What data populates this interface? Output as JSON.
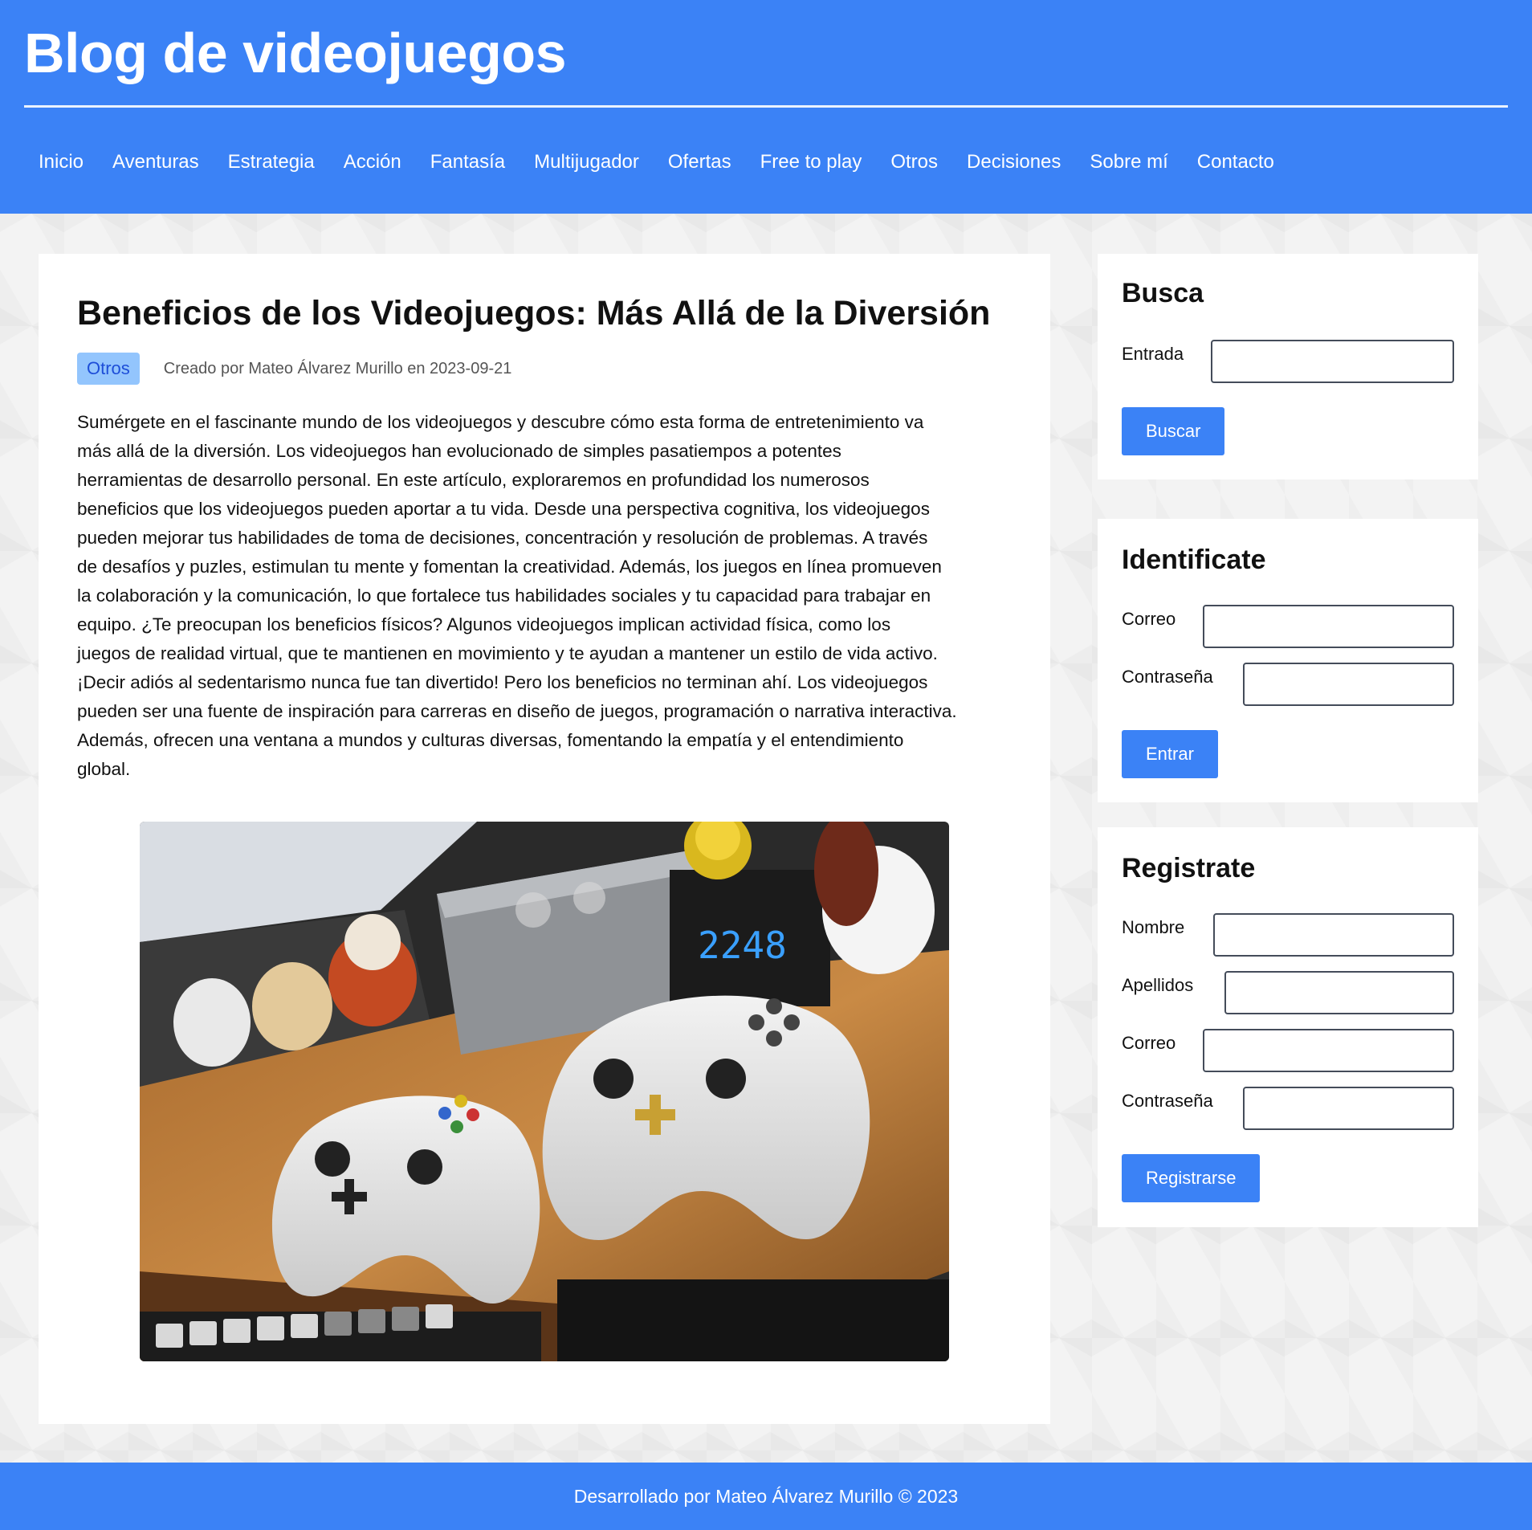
{
  "site": {
    "title": "Blog de videojuegos"
  },
  "nav": [
    "Inicio",
    "Aventuras",
    "Estrategia",
    "Acción",
    "Fantasía",
    "Multijugador",
    "Ofertas",
    "Free to play",
    "Otros",
    "Decisiones",
    "Sobre mí",
    "Contacto"
  ],
  "post": {
    "title": "Beneficios de los Videojuegos: Más Allá de la Diversión",
    "category": "Otros",
    "meta": "Creado por Mateo Álvarez Murillo en 2023-09-21",
    "lines": [
      "Sumérgete en el fascinante mundo de los videojuegos y descubre cómo esta forma de entretenimiento va",
      "más allá de la diversión. Los videojuegos han evolucionado de simples pasatiempos a potentes",
      "herramientas de desarrollo personal. En este artículo, exploraremos en profundidad los numerosos",
      "beneficios que los videojuegos pueden aportar a tu vida. Desde una perspectiva cognitiva, los videojuegos",
      "pueden mejorar tus habilidades de toma de decisiones, concentración y resolución de problemas. A través",
      "de desafíos y puzles, estimulan tu mente y fomentan la creatividad. Además, los juegos en línea promueven",
      "la colaboración y la comunicación, lo que fortalece tus habilidades sociales y tu capacidad para trabajar en",
      "equipo. ¿Te preocupan los beneficios físicos? Algunos videojuegos implican actividad física, como los",
      "juegos de realidad virtual, que te mantienen en movimiento y te ayudan a mantener un estilo de vida activo.",
      "¡Decir adiós al sedentarismo nunca fue tan divertido! Pero los beneficios no terminan ahí. Los videojuegos",
      "pueden ser una fuente de inspiración para carreras en diseño de juegos, programación o narrativa interactiva.",
      "Además, ofrecen una ventana a mundos y culturas diversas, fomentando la empatía y el entendimiento",
      "global."
    ],
    "image": {
      "clock_display": "2248"
    }
  },
  "search": {
    "title": "Busca",
    "label": "Entrada",
    "button": "Buscar"
  },
  "login": {
    "title": "Identificate",
    "email_label": "Correo",
    "password_label": "Contraseña",
    "button": "Entrar"
  },
  "register": {
    "title": "Registrate",
    "name_label": "Nombre",
    "surname_label": "Apellidos",
    "email_label": "Correo",
    "password_label": "Contraseña",
    "button": "Registrarse"
  },
  "footer": {
    "text": "Desarrollado por Mateo Álvarez Murillo © 2023"
  }
}
